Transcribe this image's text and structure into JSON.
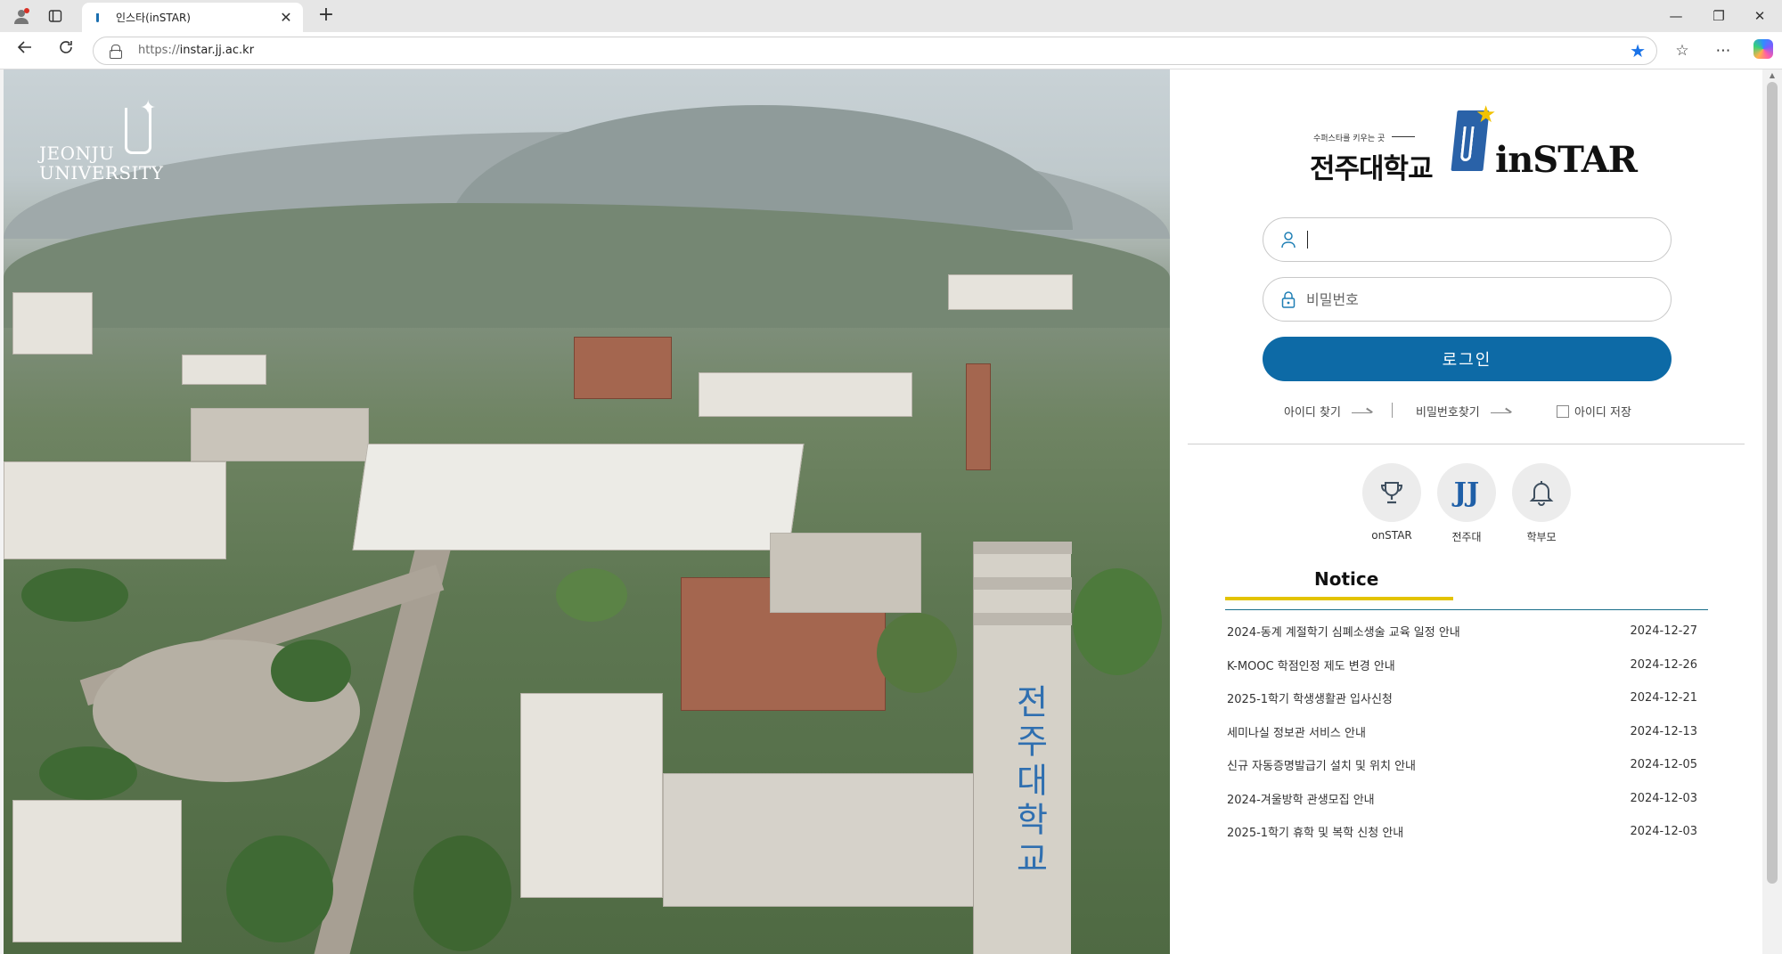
{
  "browser": {
    "tab_title": "인스타(inSTAR)",
    "url_protocol": "https://",
    "url_host": "instar.jj.ac.kr"
  },
  "hero": {
    "logo_line1": "JEONJU",
    "logo_line2": "UNIVERSITY",
    "tower_text": "전주대학교"
  },
  "brand": {
    "slogan": "수퍼스타를 키우는 곳",
    "name_ko": "전주대학교",
    "name_en": "inSTAR"
  },
  "login": {
    "id_placeholder": "",
    "password_placeholder": "비밀번호",
    "button_label": "로그인",
    "find_id": "아이디 찾기",
    "find_password": "비밀번호찾기",
    "save_id": "아이디 저장"
  },
  "quick_links": [
    {
      "label": "onSTAR",
      "icon": "trophy-icon"
    },
    {
      "label": "전주대",
      "icon": "jj-logo-icon"
    },
    {
      "label": "학부모",
      "icon": "bell-icon"
    }
  ],
  "notice": {
    "title": "Notice",
    "items": [
      {
        "title": "2024-동계 계절학기 심폐소생술 교육 일정 안내",
        "date": "2024-12-27"
      },
      {
        "title": "K-MOOC 학점인정 제도 변경 안내",
        "date": "2024-12-26"
      },
      {
        "title": "2025-1학기 학생생활관 입사신청",
        "date": "2024-12-21"
      },
      {
        "title": "세미나실 정보관 서비스 안내",
        "date": "2024-12-13"
      },
      {
        "title": "신규 자동증명발급기 설치 및 위치 안내",
        "date": "2024-12-05"
      },
      {
        "title": "2024-겨울방학 관생모집 안내",
        "date": "2024-12-03"
      },
      {
        "title": "2025-1학기 휴학 및 복학 신청 안내",
        "date": "2024-12-03"
      }
    ]
  },
  "colors": {
    "primary": "#0d6aa6",
    "accent": "#e3c300",
    "brand_blue": "#2a62a8"
  }
}
